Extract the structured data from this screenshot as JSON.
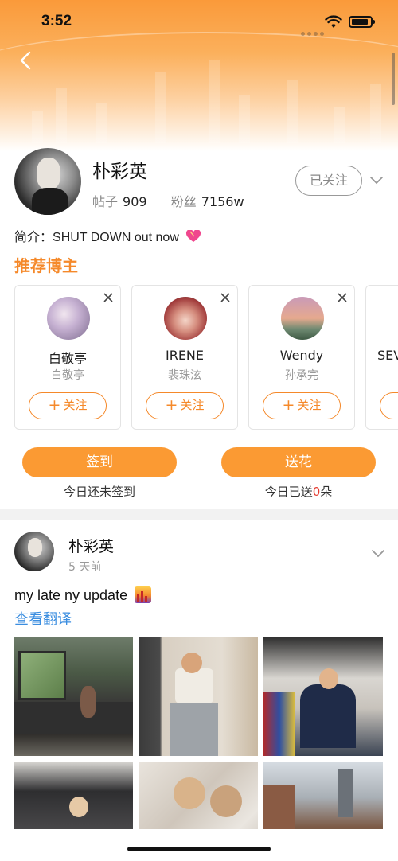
{
  "status_bar": {
    "time": "3:52"
  },
  "profile": {
    "name": "朴彩英",
    "posts_label": "帖子",
    "posts_count": "909",
    "fans_label": "粉丝",
    "fans_count": "7156w",
    "follow_state": "已关注",
    "bio_label": "简介：",
    "bio_text": "SHUT DOWN out now"
  },
  "recommended": {
    "title": "推荐博主",
    "follow_label": "关注",
    "items": [
      {
        "name": "白敬亭",
        "subtitle": "白敬亭"
      },
      {
        "name": "IRENE",
        "subtitle": "裴珠泫"
      },
      {
        "name": "Wendy",
        "subtitle": "孙承完"
      },
      {
        "name": "SEV",
        "subtitle": ""
      }
    ]
  },
  "actions": {
    "checkin_label": "签到",
    "checkin_caption": "今日还未签到",
    "flowers_label": "送花",
    "flowers_caption_prefix": "今日已送",
    "flowers_count": "0",
    "flowers_caption_suffix": "朵"
  },
  "post": {
    "author": "朴彩英",
    "time": "5 天前",
    "text": "my late ny update",
    "translate_label": "查看翻译"
  },
  "colors": {
    "accent": "#f5892a",
    "button": "#fb9a33",
    "link": "#3b8ee0",
    "highlight_red": "#e53a2f"
  },
  "icons": [
    "back-arrow-icon",
    "wifi-icon",
    "battery-icon",
    "chevron-down-icon",
    "close-icon",
    "plus-icon",
    "heart-emoji-icon",
    "city-sunset-emoji-icon"
  ]
}
